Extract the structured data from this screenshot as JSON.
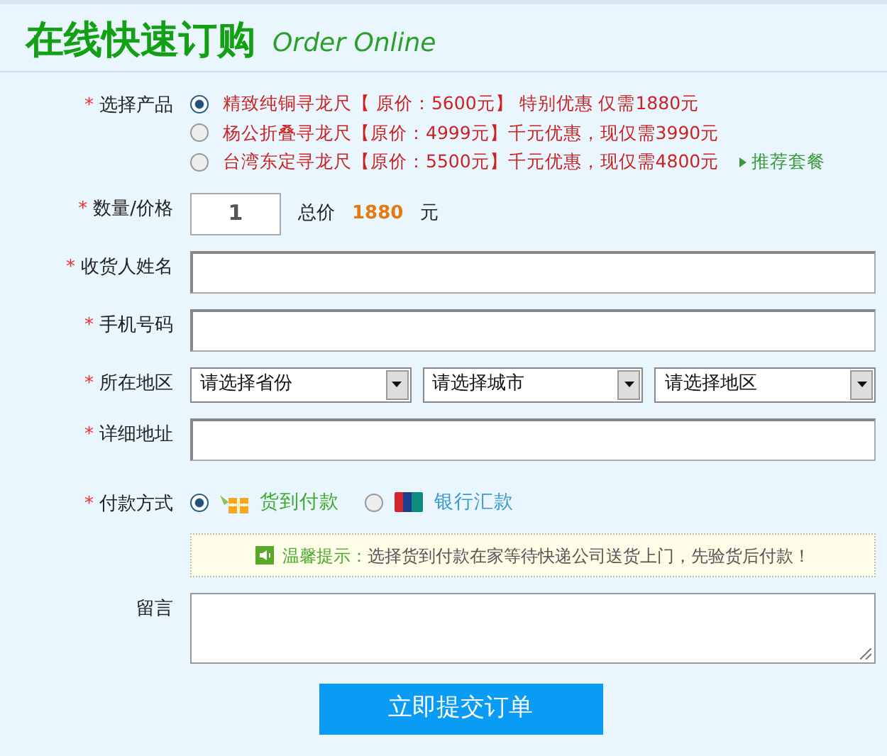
{
  "header": {
    "title": "在线快速订购",
    "subtitle": "Order Online"
  },
  "product": {
    "mark": "*",
    "label": "选择产品",
    "options": [
      {
        "text": "精致纯铜寻龙尺【 原价：5600元】 特别优惠 仅需1880元",
        "selected": true
      },
      {
        "text": "杨公折叠寻龙尺【原价：4999元】千元优惠，现仅需3990元",
        "selected": false
      },
      {
        "text": "台湾东定寻龙尺【原价：5500元】千元优惠，现仅需4800元",
        "selected": false,
        "link": "推荐套餐"
      }
    ]
  },
  "quantity": {
    "mark": "*",
    "label": "数量/价格",
    "value": "1",
    "total_label": "总价",
    "total": "1880",
    "unit": "元"
  },
  "name": {
    "mark": "*",
    "label": "收货人姓名"
  },
  "phone": {
    "mark": "*",
    "label": "手机号码"
  },
  "region": {
    "mark": "*",
    "label": "所在地区",
    "selects": [
      "请选择省份",
      "请选择城市",
      "请选择地区"
    ]
  },
  "address": {
    "mark": "*",
    "label": "详细地址"
  },
  "payment": {
    "mark": "*",
    "label": "付款方式",
    "options": [
      {
        "kind": "cod",
        "text": "货到付款",
        "selected": true
      },
      {
        "kind": "bank",
        "text": "银行汇款",
        "selected": false
      }
    ]
  },
  "tip": {
    "title": "温馨提示：",
    "text": "选择货到付款在家等待快递公司送货上门，先验货后付款！"
  },
  "message": {
    "label": "留言"
  },
  "submit": "立即提交订单"
}
